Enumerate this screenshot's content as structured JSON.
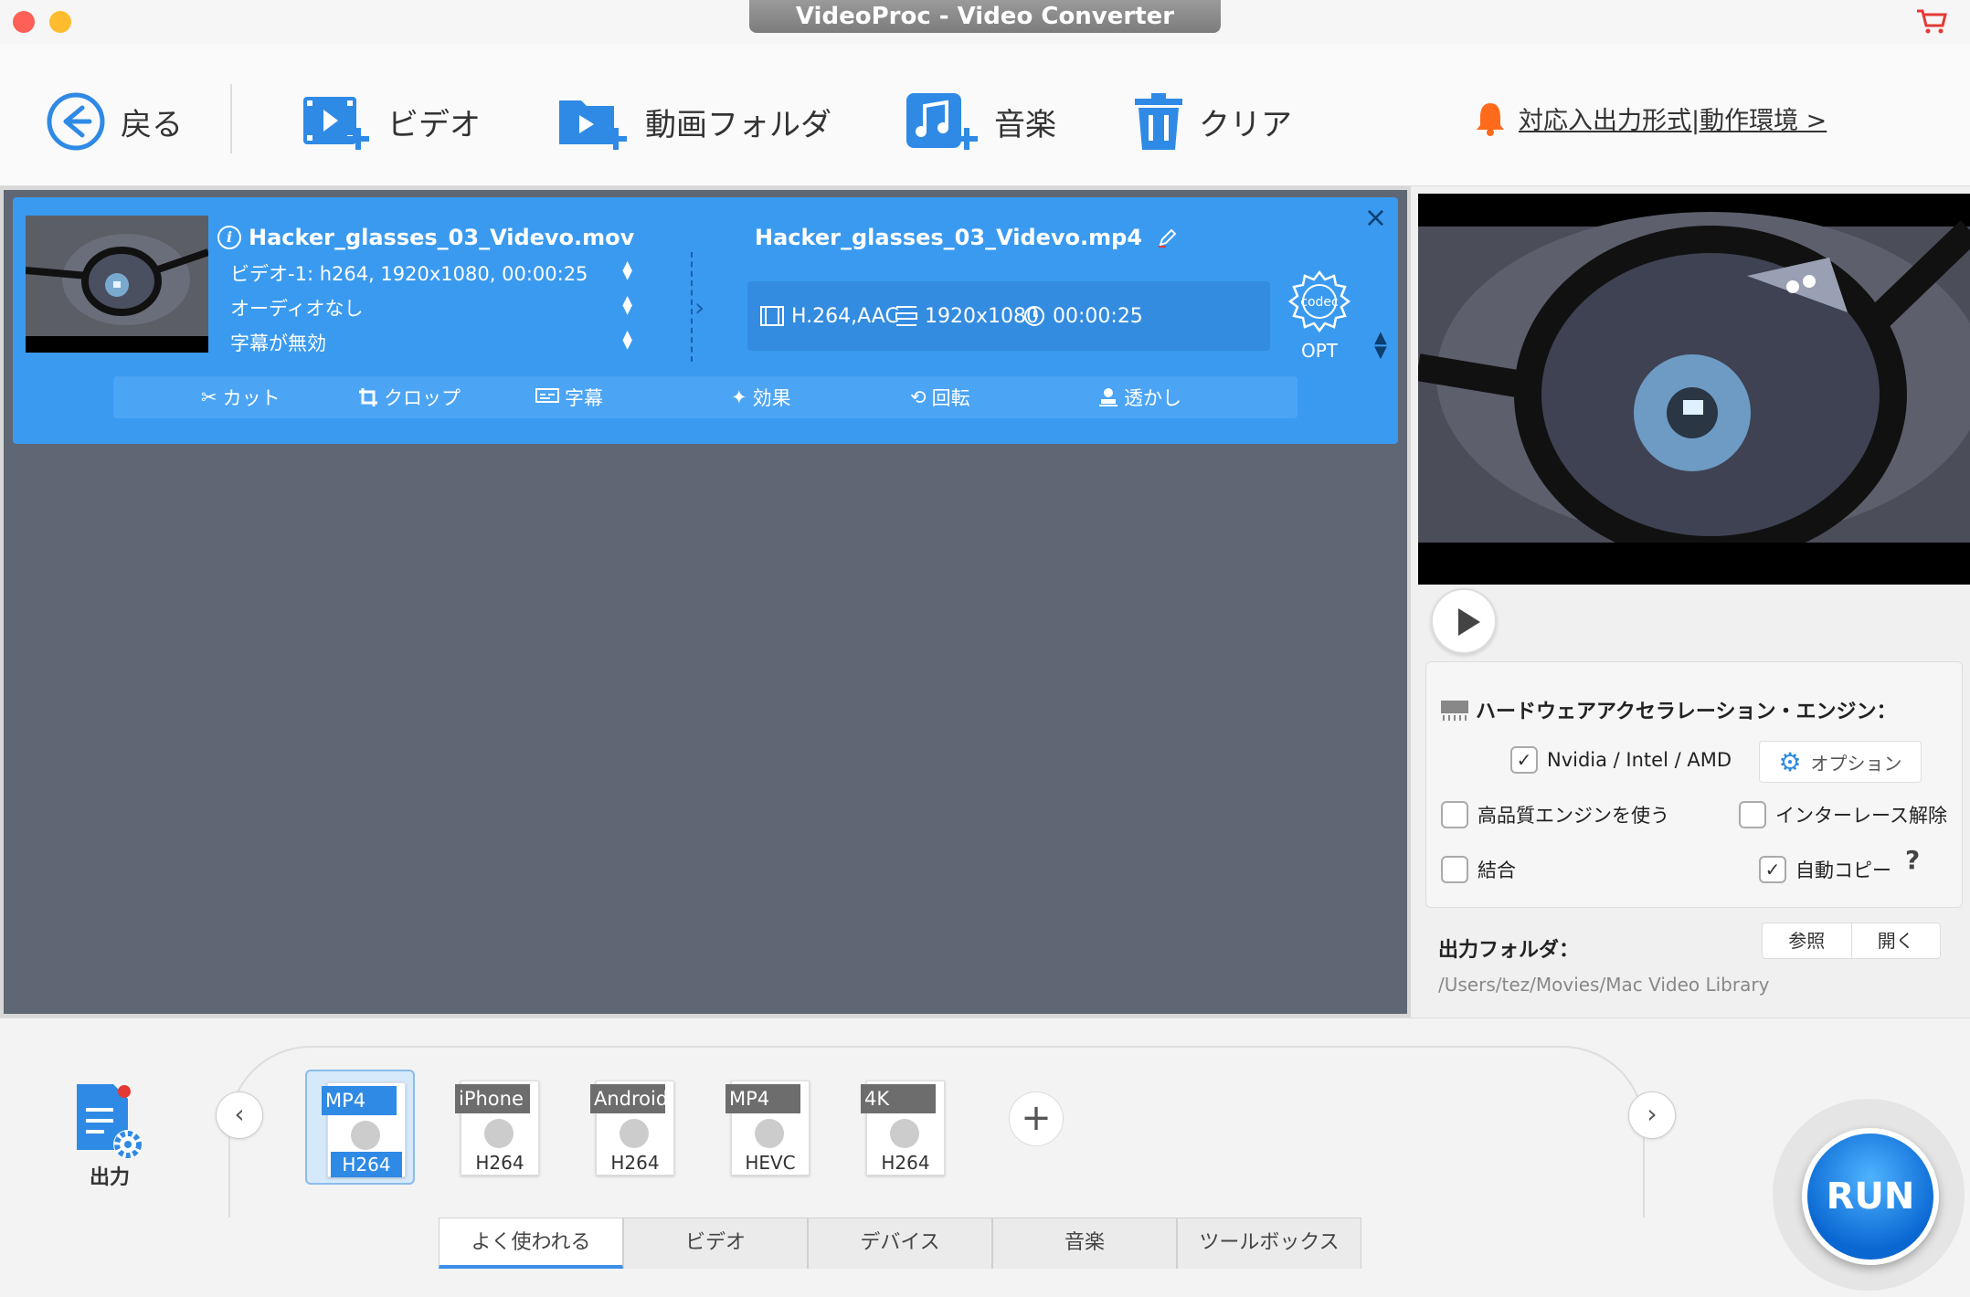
{
  "window": {
    "title": "VideoProc - Video Converter"
  },
  "toolbar": {
    "back": "戻る",
    "video": "ビデオ",
    "video_folder": "動画フォルダ",
    "music": "音楽",
    "clear": "クリア",
    "formats_link": "対応入出力形式|動作環境 >"
  },
  "task": {
    "source_name": "Hacker_glasses_03_Videvo.mov",
    "video_track": "ビデオ-1: h264, 1920x1080, 00:00:25",
    "audio_track": "オーディオなし",
    "subtitle_track": "字幕が無効",
    "output_name": "Hacker_glasses_03_Videvo.mp4",
    "codec": "H.264,AAC",
    "resolution": "1920x1080",
    "duration": "00:00:25",
    "codec_badge": "codec",
    "codec_opt": "OPT",
    "edit": {
      "cut": "カット",
      "crop": "クロップ",
      "subtitle": "字幕",
      "effect": "効果",
      "rotate": "回転",
      "watermark": "透かし"
    }
  },
  "hardware": {
    "title": "ハードウェアアクセラレーション・エンジン：",
    "gpu_label": "Nvidia /   Intel / AMD",
    "gpu_checked": true,
    "option_button": "オプション",
    "high_quality": "高品質エンジンを使う",
    "deinterlace": "インターレース解除",
    "merge": "結合",
    "auto_copy": "自動コピー",
    "auto_copy_checked": true,
    "help": "?"
  },
  "output_folder": {
    "label": "出力フォルダ：",
    "browse": "参照",
    "open": "開く",
    "path": "/Users/tez/Movies/Mac Video Library"
  },
  "bottom": {
    "output_label": "出力",
    "formats": [
      {
        "top": "MP4",
        "bottom": "H264",
        "selected": true
      },
      {
        "top": "iPhone",
        "bottom": "H264"
      },
      {
        "top": "Android",
        "bottom": "H264"
      },
      {
        "top": "MP4",
        "bottom": "HEVC"
      },
      {
        "top": "4K",
        "bottom": "H264"
      }
    ],
    "tabs": [
      "よく使われる",
      "ビデオ",
      "デバイス",
      "音楽",
      "ツールボックス"
    ],
    "run": "RUN"
  },
  "colors": {
    "accent": "#3a9af0",
    "run": "#0a67d2"
  }
}
